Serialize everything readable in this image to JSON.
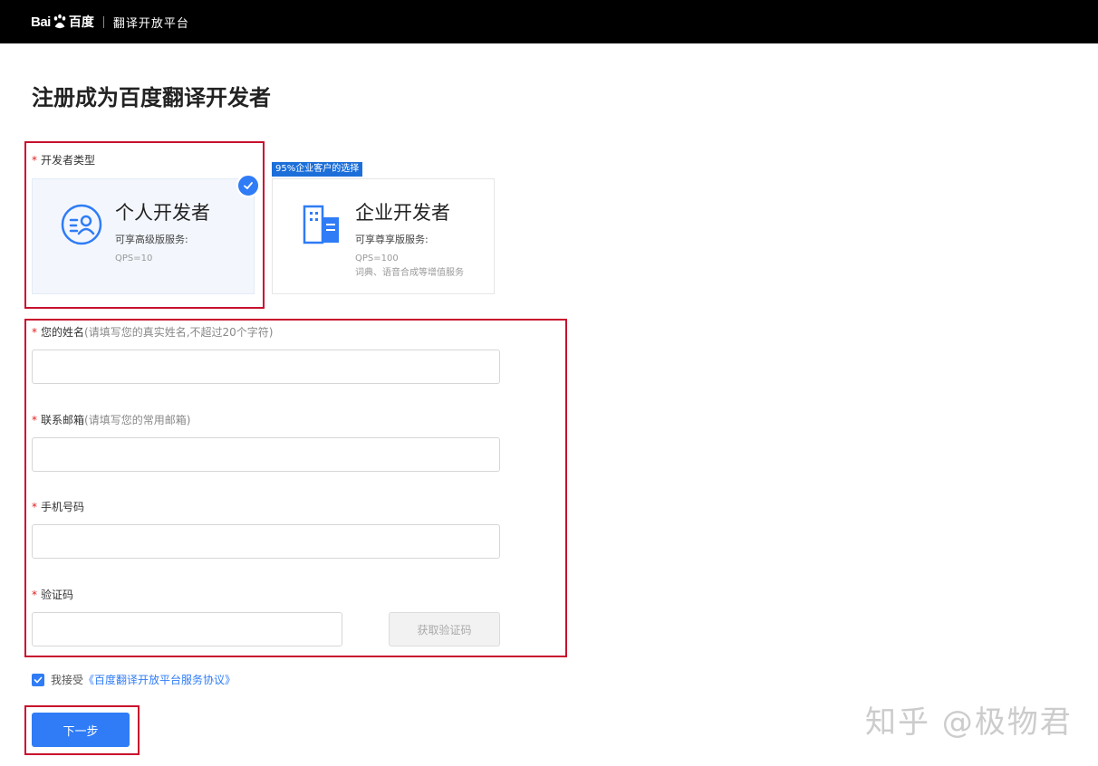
{
  "header": {
    "logo_bai": "Bai",
    "logo_du": "百度",
    "product_name": "翻译开放平台"
  },
  "page_title": "注册成为百度翻译开发者",
  "developer_type": {
    "label": "开发者类型",
    "promo_tag": "95%企业客户的选择",
    "options": [
      {
        "title": "个人开发者",
        "desc": "可享高级版服务:",
        "spec": [
          "QPS=10"
        ],
        "selected": true
      },
      {
        "title": "企业开发者",
        "desc": "可享尊享版服务:",
        "spec": [
          "QPS=100",
          "词典、语音合成等增值服务"
        ],
        "selected": false
      }
    ]
  },
  "form": {
    "name": {
      "label": "您的姓名",
      "hint": "(请填写您的真实姓名,不超过20个字符)",
      "value": ""
    },
    "email": {
      "label": "联系邮箱",
      "hint": "(请填写您的常用邮箱)",
      "value": ""
    },
    "phone": {
      "label": "手机号码",
      "value": ""
    },
    "code": {
      "label": "验证码",
      "value": "",
      "button": "获取验证码"
    }
  },
  "agreement": {
    "checked": true,
    "text": "我接受",
    "link": "《百度翻译开放平台服务协议》"
  },
  "next_button": "下一步",
  "watermark": "知乎 @极物君",
  "colors": {
    "primary": "#2f7cf6",
    "highlight": "#c8102e",
    "header_bg": "#000000",
    "promo": "#1c6fd9"
  }
}
